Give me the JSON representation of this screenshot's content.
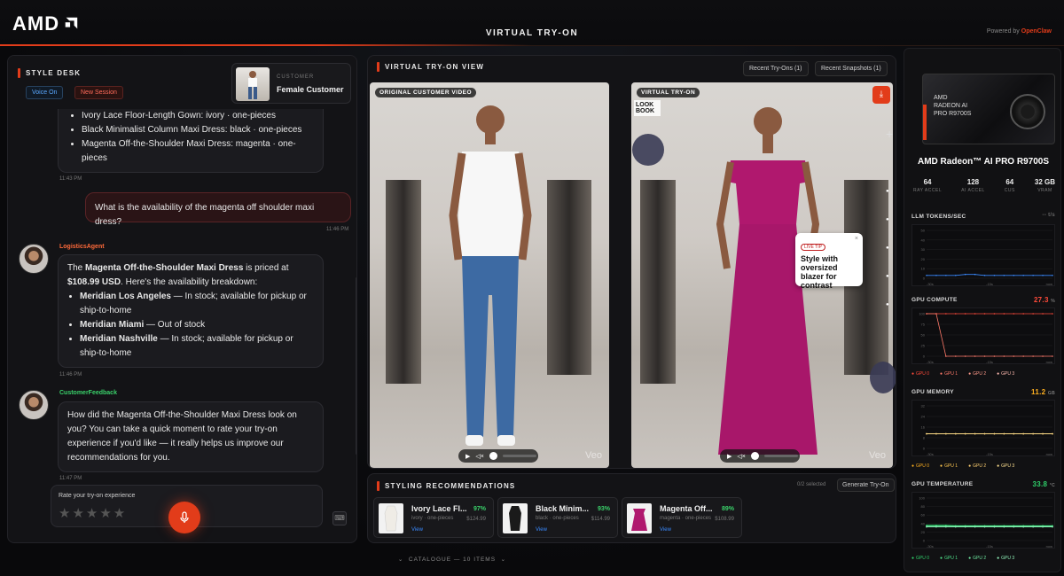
{
  "app": {
    "logo": "AMD",
    "title": "VIRTUAL TRY-ON",
    "powered_prefix": "Powered by ",
    "powered_brand": "OpenClaw"
  },
  "left": {
    "title": "STYLE DESK",
    "voice_chip": "Voice On",
    "session_chip": "New Session",
    "customer_label": "CUSTOMER",
    "customer_name": "Female Customer",
    "first_list": [
      "Ivory Lace Floor-Length Gown: ivory · one-pieces",
      "Black Minimalist Column Maxi Dress: black · one-pieces",
      "Magenta Off-the-Shoulder Maxi Dress: magenta · one-pieces"
    ],
    "ts1": "11:43 PM",
    "user_message": "What is the availability of the magenta off shoulder maxi dress?",
    "ts2": "11:46 PM",
    "agent1_name": "LogisticsAgent",
    "agent1_intro_a": "The ",
    "agent1_intro_b": "Magenta Off-the-Shoulder Maxi Dress",
    "agent1_intro_c": " is priced at ",
    "agent1_price": "$108.99 USD",
    "agent1_intro_d": ". Here's the availability breakdown:",
    "agent1_items": [
      {
        "store": "Meridian Los Angeles",
        "status": " — In stock; available for pickup or ship-to-home"
      },
      {
        "store": "Meridian Miami",
        "status": " — Out of stock"
      },
      {
        "store": "Meridian Nashville",
        "status": " — In stock; available for pickup or ship-to-home"
      }
    ],
    "ts3": "11:46 PM",
    "agent2_name": "CustomerFeedback",
    "agent2_message": "How did the Magenta Off-the-Shoulder Maxi Dress look on you? You can take a quick moment to rate your try-on experience if you'd like — it really helps us improve our recommendations for you.",
    "ts4": "11:47 PM",
    "rating_label": "Rate your try-on experience",
    "stars": "★★★★★",
    "keyboard_icon": "keyboard-icon",
    "mic_icon": "microphone-icon"
  },
  "center": {
    "title": "VIRTUAL TRY-ON VIEW",
    "recent_tryons": "Recent Try-Ons (1)",
    "recent_snapshots": "Recent Snapshots (1)",
    "video1_label": "ORIGINAL CUSTOMER VIDEO",
    "video2_label": "VIRTUAL TRY-ON",
    "watermark": "Veo",
    "lookbook": "LOOK BOOK",
    "callout_badge": "LIVE TIP",
    "callout_text": "Style with oversized blazer for contrast",
    "callout_close": "×",
    "player_play": "▶",
    "player_mute": "◁×",
    "side_plus": "+",
    "download_icon": "download-icon"
  },
  "recs": {
    "title": "STYLING RECOMMENDATIONS",
    "selected": "0/2 selected",
    "generate": "Generate Try-On",
    "items": [
      {
        "name": "Ivory Lace Fl...",
        "sub": "ivory · one-pieces",
        "pct": "97%",
        "price": "$124.99",
        "view": "View",
        "color": "#efece6"
      },
      {
        "name": "Black Minim...",
        "sub": "black · one-pieces",
        "pct": "93%",
        "price": "$114.99",
        "view": "View",
        "color": "#1a1a1a"
      },
      {
        "name": "Magenta Off...",
        "sub": "magenta · one-pieces",
        "pct": "89%",
        "price": "$108.99",
        "view": "View",
        "color": "#b0186e"
      }
    ],
    "catalogue": "CATALOGUE — 10 ITEMS"
  },
  "right": {
    "gpu_box_text": "AMD\nRADEON AI\nPRO R9700S",
    "gpu_name": "AMD Radeon™ AI PRO R9700S",
    "specs": [
      {
        "v": "64",
        "l": "RAY ACCEL"
      },
      {
        "v": "128",
        "l": "AI ACCEL"
      },
      {
        "v": "64",
        "l": "CUS"
      },
      {
        "v": "32 GB",
        "l": "VRAM"
      }
    ],
    "llm_title": "LLM TOKENS/SEC",
    "llm_val": "-- t/s",
    "compute_title": "GPU COMPUTE",
    "compute_val": "27.3",
    "compute_unit": "%",
    "memory_title": "GPU MEMORY",
    "memory_val": "11.2",
    "memory_unit": "GB",
    "temp_title": "GPU TEMPERATURE",
    "temp_val": "33.8",
    "temp_unit": "°C",
    "legend": [
      "GPU 0",
      "GPU 1",
      "GPU 2",
      "GPU 3"
    ],
    "axis_labels": [
      "-30s",
      "-15s",
      "now"
    ],
    "colors": {
      "compute": "#ff4a3a",
      "memory": "#ffb020",
      "temp": "#2fd06a",
      "llm": "#3a8aff"
    }
  },
  "chart_data": [
    {
      "type": "line",
      "title": "LLM TOKENS/SEC",
      "ylim": [
        0,
        50
      ],
      "yticks": [
        50,
        40,
        30,
        20,
        10,
        0
      ],
      "series": [
        {
          "values": [
            3,
            3,
            3,
            3,
            4,
            4,
            3,
            3,
            3,
            3,
            3,
            3,
            3,
            3
          ]
        }
      ]
    },
    {
      "type": "line",
      "title": "GPU COMPUTE",
      "ylim": [
        0,
        100
      ],
      "yticks": [
        100,
        75,
        50,
        25,
        0
      ],
      "series": [
        {
          "name": "GPU 0",
          "values": [
            100,
            100,
            100,
            100,
            100,
            100,
            100,
            100,
            100,
            100,
            100,
            100,
            100,
            100
          ]
        },
        {
          "name": "GPU 1",
          "values": [
            100,
            100,
            0,
            0,
            0,
            0,
            0,
            0,
            0,
            0,
            0,
            0,
            0,
            0
          ]
        }
      ]
    },
    {
      "type": "line",
      "title": "GPU MEMORY",
      "ylim": [
        0,
        32
      ],
      "yticks": [
        32,
        24,
        16,
        8,
        0
      ],
      "series": [
        {
          "name": "GPU 0",
          "values": [
            11,
            11,
            11,
            11,
            11,
            11,
            11,
            11,
            11,
            11,
            11,
            11,
            11,
            11
          ]
        },
        {
          "name": "GPU 1",
          "values": [
            11,
            11,
            11,
            11,
            11,
            11,
            11,
            11,
            11,
            11,
            11,
            11,
            11,
            11
          ]
        },
        {
          "name": "GPU 2",
          "values": [
            11,
            11,
            11,
            11,
            11,
            11,
            11,
            11,
            11,
            11,
            11,
            11,
            11,
            11
          ]
        },
        {
          "name": "GPU 3",
          "values": [
            11,
            11,
            11,
            11,
            11,
            11,
            11,
            11,
            11,
            11,
            11,
            11,
            11,
            11
          ]
        }
      ]
    },
    {
      "type": "line",
      "title": "GPU TEMPERATURE",
      "ylim": [
        0,
        100
      ],
      "yticks": [
        100,
        80,
        60,
        40,
        20,
        0
      ],
      "series": [
        {
          "name": "GPU 0",
          "values": [
            36,
            36,
            36,
            35,
            35,
            35,
            35,
            35,
            35,
            35,
            35,
            35,
            35,
            35
          ]
        },
        {
          "name": "GPU 1",
          "values": [
            34,
            34,
            34,
            34,
            34,
            34,
            34,
            34,
            34,
            34,
            34,
            34,
            34,
            34
          ]
        },
        {
          "name": "GPU 2",
          "values": [
            33,
            33,
            33,
            33,
            33,
            33,
            33,
            33,
            33,
            33,
            33,
            33,
            33,
            33
          ]
        },
        {
          "name": "GPU 3",
          "values": [
            32,
            32,
            32,
            32,
            32,
            32,
            32,
            32,
            32,
            32,
            32,
            32,
            32,
            32
          ]
        }
      ]
    }
  ]
}
